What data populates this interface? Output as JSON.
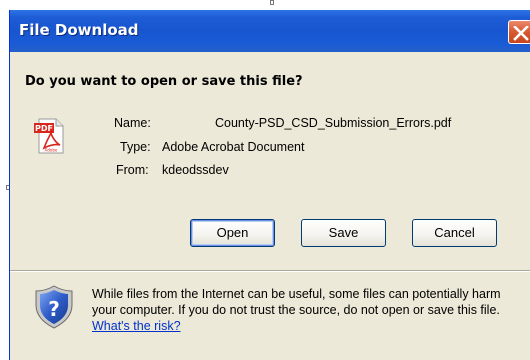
{
  "dialog": {
    "title": "File Download",
    "question": "Do you want to open or save this file?",
    "file_icon": "pdf-icon",
    "fields": {
      "name_label": "Name:",
      "name_value": "County-PSD_CSD_Submission_Errors.pdf",
      "type_label": "Type:",
      "type_value": "Adobe Acrobat Document",
      "from_label": "From:",
      "from_value": "kdeodssdev"
    },
    "buttons": {
      "open": "Open",
      "save": "Save",
      "cancel": "Cancel"
    },
    "warning": {
      "icon": "shield-question-icon",
      "text": "While files from the Internet can be useful, some files can potentially harm your computer. If you do not trust the source, do not open or save this file.",
      "link": "What's the risk?"
    },
    "pdf_badge": "PDF",
    "pdf_brand": "Adobe"
  },
  "colors": {
    "titlebar": "#1756CF",
    "dialog_bg": "#ECE9D8",
    "close_button": "#D7592F",
    "link": "#0033CC",
    "pdf_red": "#D9261C"
  }
}
